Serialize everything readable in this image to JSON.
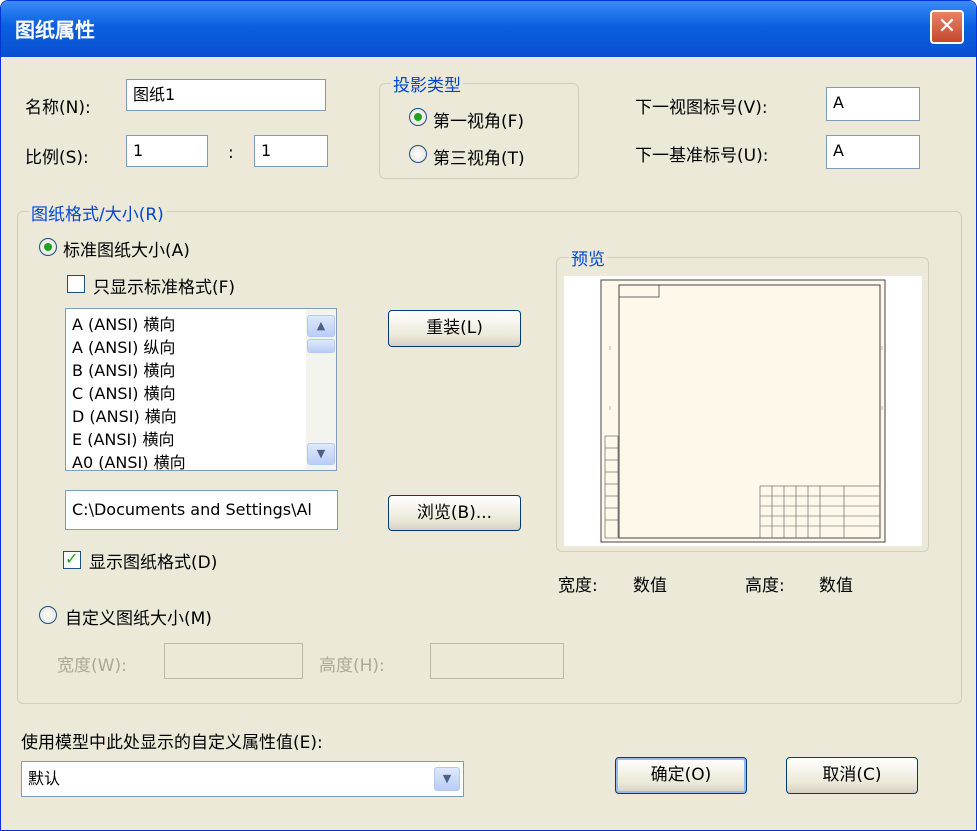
{
  "dialog": {
    "title": "图纸属性",
    "close_glyph": "✕"
  },
  "name": {
    "label": "名称(N):",
    "value": "图纸1"
  },
  "scale": {
    "label": "比例(S):",
    "left": "1",
    "separator": ":",
    "right": "1"
  },
  "projection": {
    "legend": "投影类型",
    "first_angle": "第一视角(F)",
    "third_angle": "第三视角(T)",
    "selected": "first_angle"
  },
  "next_view": {
    "label": "下一视图标号(V):",
    "value": "A"
  },
  "next_datum": {
    "label": "下一基准标号(U):",
    "value": "A"
  },
  "sheet_format": {
    "legend": "图纸格式/大小(R)",
    "standard_size_label": "标准图纸大小(A)",
    "only_standard_label": "只显示标准格式(F)",
    "list_items": [
      "A (ANSI) 横向",
      "A (ANSI) 纵向",
      "B (ANSI) 横向",
      "C (ANSI) 横向",
      "D (ANSI) 横向",
      "E (ANSI) 横向",
      "A0 (ANSI) 横向"
    ],
    "reload_button": "重装(L)",
    "path_value": "C:\\Documents and Settings\\Al",
    "browse_button": "浏览(B)...",
    "show_format_label": "显示图纸格式(D)",
    "custom_size_label": "自定义图纸大小(M)",
    "width_label": "宽度(W):",
    "height_label": "高度(H):"
  },
  "preview": {
    "legend": "预览",
    "width_label": "宽度:",
    "width_value": "数值",
    "height_label": "高度:",
    "height_value": "数值"
  },
  "custom_prop": {
    "label": "使用模型中此处显示的自定义属性值(E):",
    "selected": "默认"
  },
  "buttons": {
    "ok": "确定(O)",
    "cancel": "取消(C)"
  },
  "colors": {
    "title_bar": "#0a5fe0",
    "dialog_bg": "#ece9d8",
    "legend_text": "#0046d5",
    "check_green": "#21a121",
    "preview_sheet": "#fdf8ea"
  }
}
